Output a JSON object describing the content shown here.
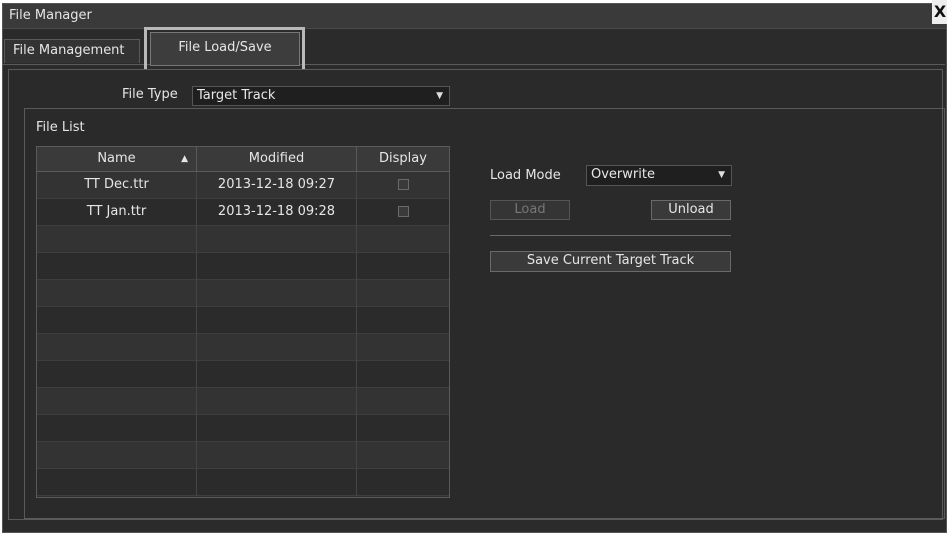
{
  "window": {
    "title": "File Manager",
    "close_label": "X"
  },
  "tabs": [
    {
      "label": "File Management"
    },
    {
      "label": "File Load/Save"
    }
  ],
  "file_type": {
    "label": "File Type",
    "value": "Target Track"
  },
  "file_list": {
    "title": "File List",
    "columns": [
      "Name",
      "Modified",
      "Display"
    ],
    "rows": [
      {
        "name": "TT Dec.ttr",
        "modified": "2013-12-18 09:27",
        "display": false
      },
      {
        "name": "TT Jan.ttr",
        "modified": "2013-12-18 09:28",
        "display": false
      }
    ]
  },
  "load_mode": {
    "label": "Load Mode",
    "value": "Overwrite"
  },
  "buttons": {
    "load": "Load",
    "unload": "Unload",
    "save": "Save Current Target Track"
  },
  "colors": {
    "background": "#2b2b2b",
    "text": "#e6e6e6",
    "highlight": "#b9b9b9"
  },
  "icons": {
    "close": "close-icon",
    "dropdown": "chevron-down-icon",
    "sort": "sort-ascending-icon"
  }
}
